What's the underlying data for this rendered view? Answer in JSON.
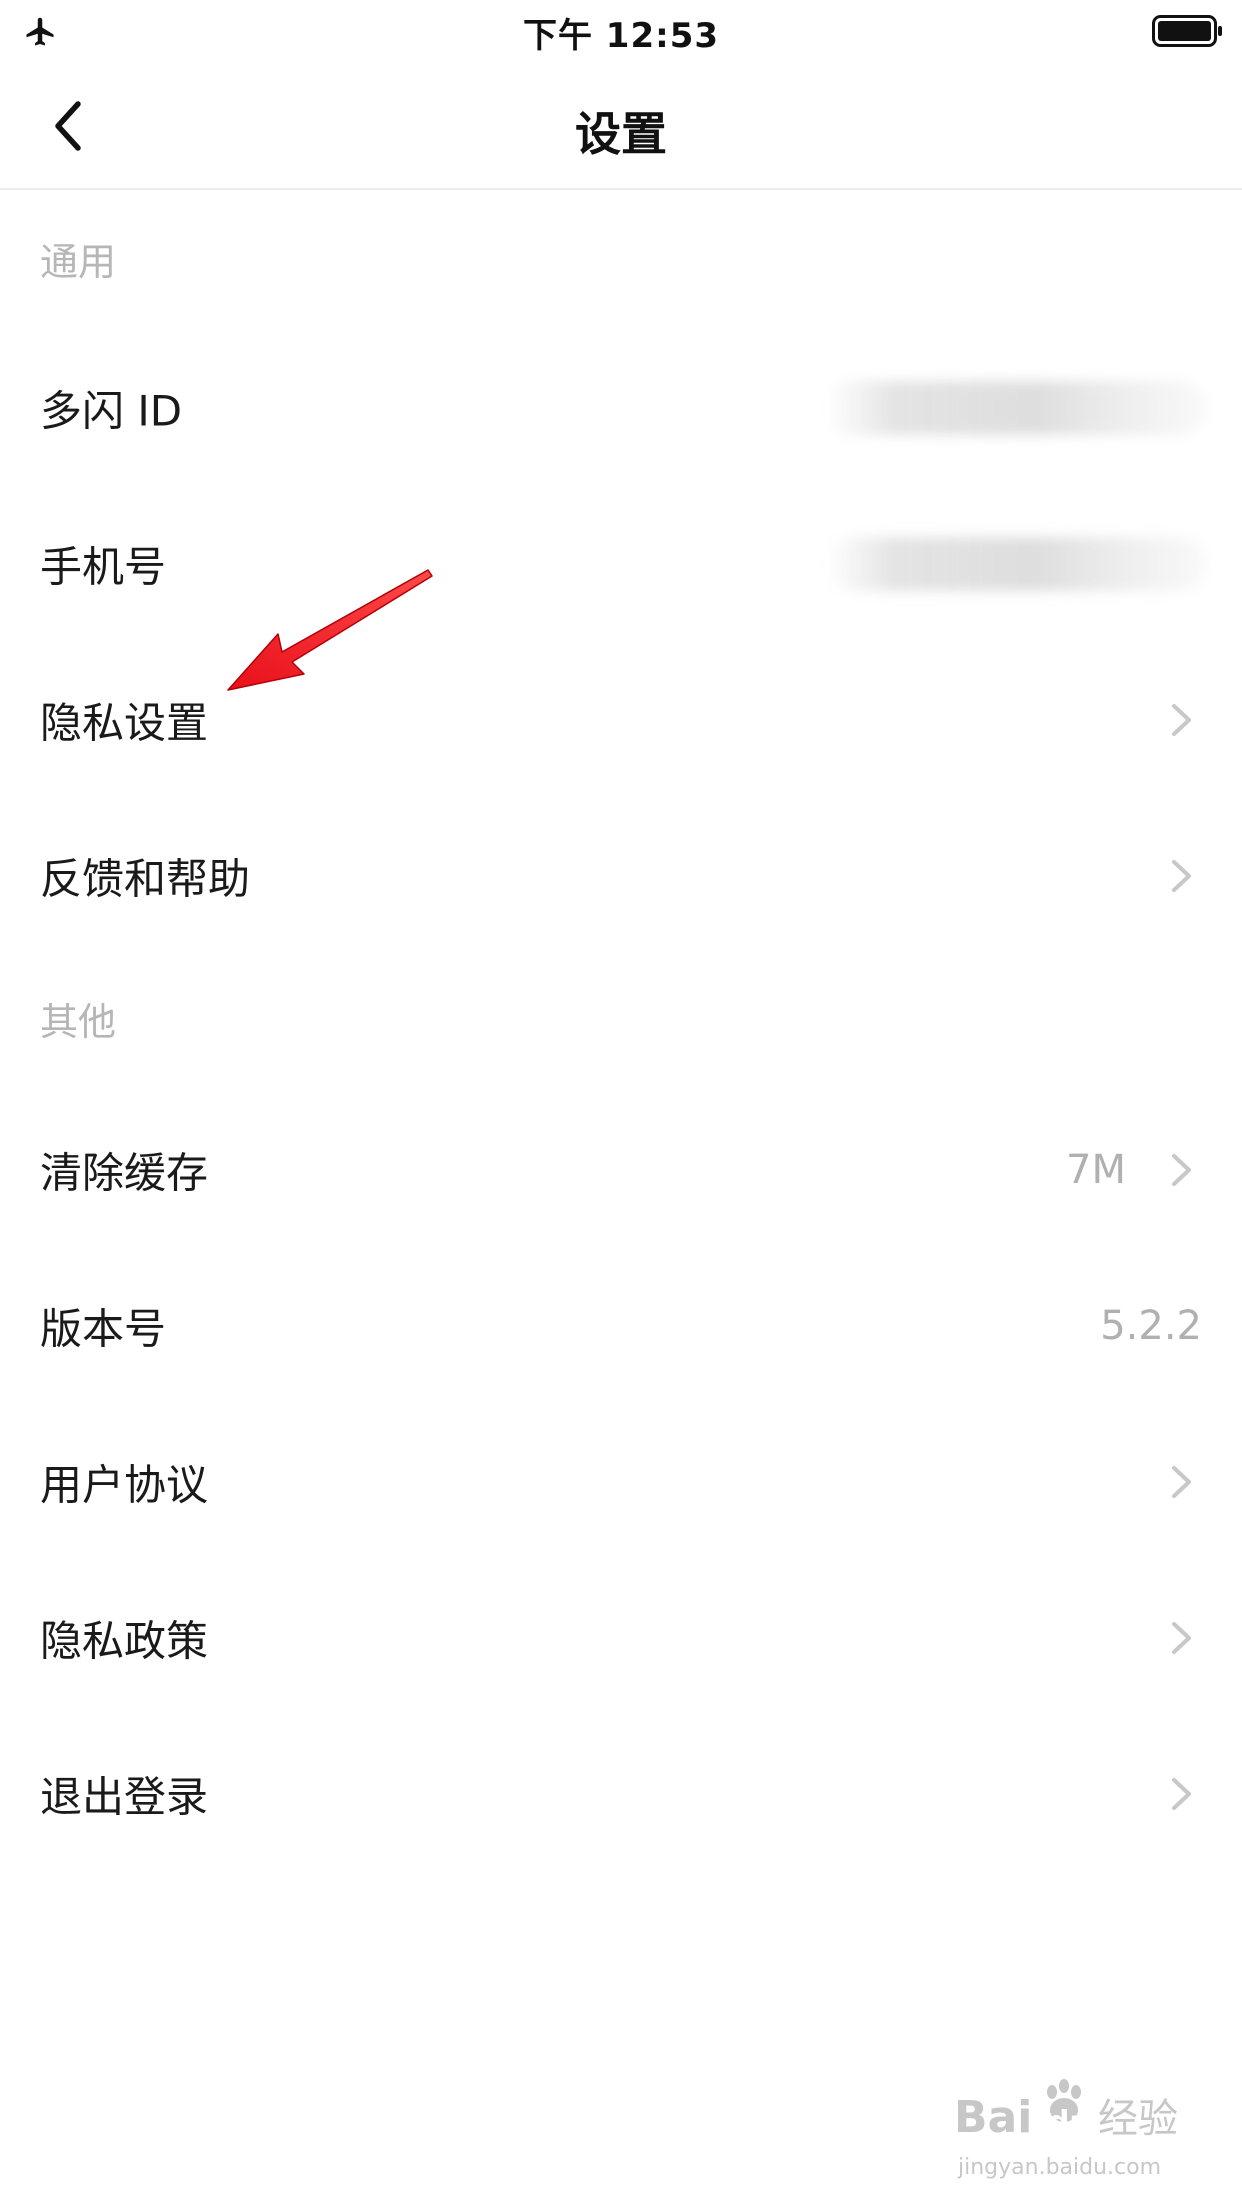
{
  "status_bar": {
    "time": "下午 12:53",
    "left_icon": "airplane-icon",
    "right_icon": "battery-icon"
  },
  "nav": {
    "title": "设置",
    "back_icon": "chevron-left-icon"
  },
  "sections": {
    "general": {
      "header": "通用",
      "items": [
        {
          "label": "多闪 ID"
        },
        {
          "label": "手机号"
        },
        {
          "label": "隐私设置"
        },
        {
          "label": "反馈和帮助"
        }
      ]
    },
    "other": {
      "header": "其他",
      "items": [
        {
          "label": "清除缓存",
          "value": "7M"
        },
        {
          "label": "版本号",
          "value": "5.2.2"
        },
        {
          "label": "用户协议"
        },
        {
          "label": "隐私政策"
        },
        {
          "label": "退出登录"
        }
      ]
    }
  },
  "watermark": {
    "brand": "Bai du 经验",
    "url": "jingyan.baidu.com"
  },
  "colors": {
    "text_primary": "#1a1a1a",
    "text_secondary": "#b0b0b0",
    "section_header": "#b6b6b6",
    "divider": "#ececec",
    "chevron": "#c7c7cc",
    "annotation_arrow": "#e8101a"
  }
}
